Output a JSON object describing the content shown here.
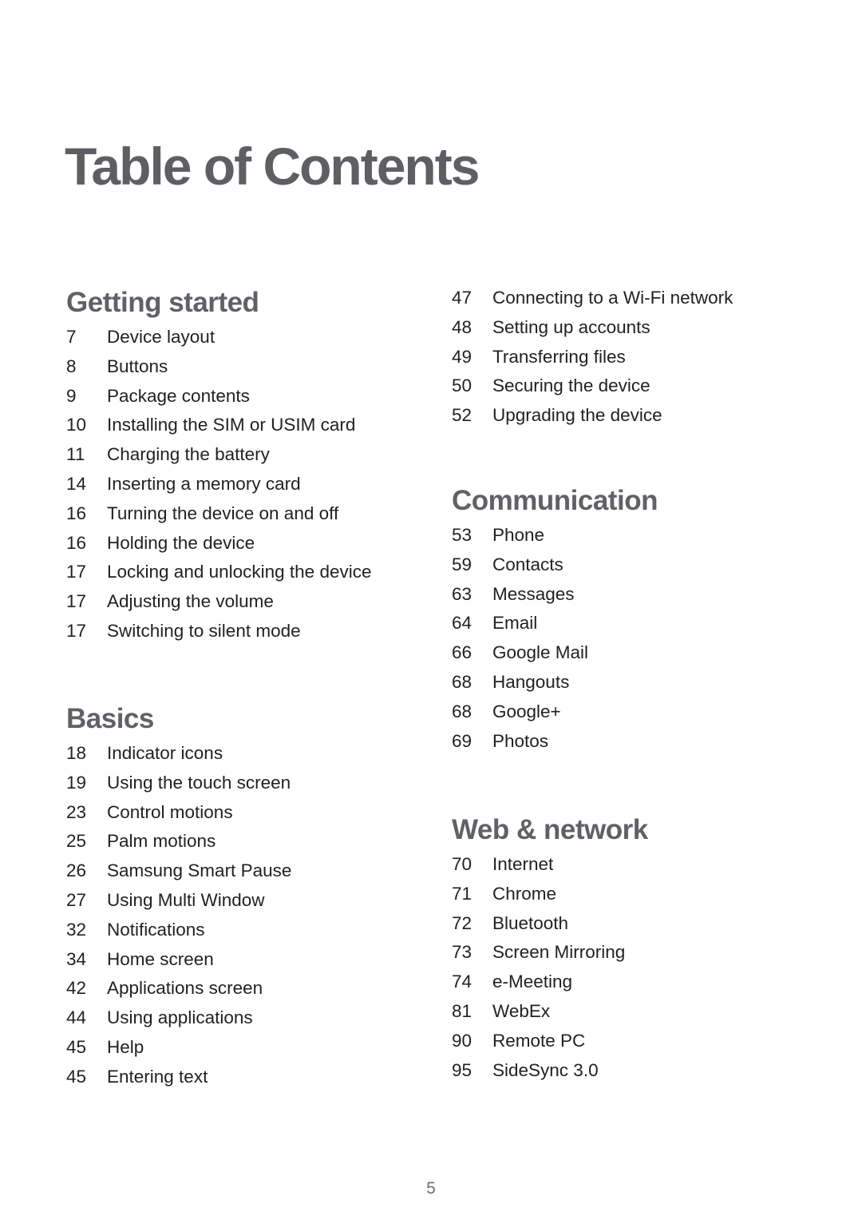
{
  "page": {
    "title": "Table of Contents",
    "page_number": "5"
  },
  "sections": [
    {
      "heading": "Getting started",
      "entries": [
        {
          "page": "7",
          "label": "Device layout"
        },
        {
          "page": "8",
          "label": "Buttons"
        },
        {
          "page": "9",
          "label": "Package contents"
        },
        {
          "page": "10",
          "label": "Installing the SIM or USIM card"
        },
        {
          "page": "11",
          "label": "Charging the battery"
        },
        {
          "page": "14",
          "label": "Inserting a memory card"
        },
        {
          "page": "16",
          "label": "Turning the device on and off"
        },
        {
          "page": "16",
          "label": "Holding the device"
        },
        {
          "page": "17",
          "label": "Locking and unlocking the device"
        },
        {
          "page": "17",
          "label": "Adjusting the volume"
        },
        {
          "page": "17",
          "label": "Switching to silent mode"
        }
      ]
    },
    {
      "heading": "Basics",
      "entries": [
        {
          "page": "18",
          "label": "Indicator icons"
        },
        {
          "page": "19",
          "label": "Using the touch screen"
        },
        {
          "page": "23",
          "label": "Control motions"
        },
        {
          "page": "25",
          "label": "Palm motions"
        },
        {
          "page": "26",
          "label": "Samsung Smart Pause"
        },
        {
          "page": "27",
          "label": "Using Multi Window"
        },
        {
          "page": "32",
          "label": "Notifications"
        },
        {
          "page": "34",
          "label": "Home screen"
        },
        {
          "page": "42",
          "label": "Applications screen"
        },
        {
          "page": "44",
          "label": "Using applications"
        },
        {
          "page": "45",
          "label": "Help"
        },
        {
          "page": "45",
          "label": "Entering text"
        }
      ]
    },
    {
      "heading": "",
      "entries": [
        {
          "page": "47",
          "label": "Connecting to a Wi-Fi network"
        },
        {
          "page": "48",
          "label": "Setting up accounts"
        },
        {
          "page": "49",
          "label": "Transferring files"
        },
        {
          "page": "50",
          "label": "Securing the device"
        },
        {
          "page": "52",
          "label": "Upgrading the device"
        }
      ]
    },
    {
      "heading": "Communication",
      "entries": [
        {
          "page": "53",
          "label": "Phone"
        },
        {
          "page": "59",
          "label": "Contacts"
        },
        {
          "page": "63",
          "label": "Messages"
        },
        {
          "page": "64",
          "label": "Email"
        },
        {
          "page": "66",
          "label": "Google Mail"
        },
        {
          "page": "68",
          "label": "Hangouts"
        },
        {
          "page": "68",
          "label": "Google+"
        },
        {
          "page": "69",
          "label": "Photos"
        }
      ]
    },
    {
      "heading": "Web & network",
      "entries": [
        {
          "page": "70",
          "label": "Internet"
        },
        {
          "page": "71",
          "label": "Chrome"
        },
        {
          "page": "72",
          "label": "Bluetooth"
        },
        {
          "page": "73",
          "label": "Screen Mirroring"
        },
        {
          "page": "74",
          "label": "e-Meeting"
        },
        {
          "page": "81",
          "label": "WebEx"
        },
        {
          "page": "90",
          "label": "Remote PC"
        },
        {
          "page": "95",
          "label": "SideSync 3.0"
        }
      ]
    }
  ]
}
